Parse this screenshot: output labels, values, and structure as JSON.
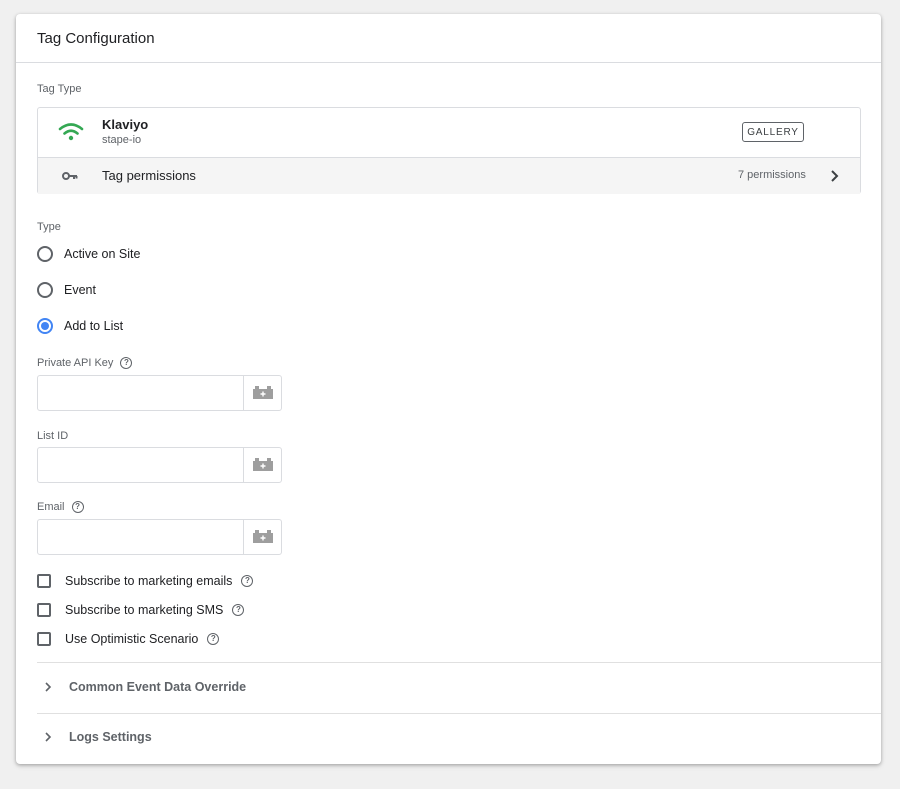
{
  "header": {
    "title": "Tag Configuration"
  },
  "tag_type": {
    "section_label": "Tag Type",
    "name": "Klaviyo",
    "author": "stape-io",
    "logo_icon": "klaviyo-wifi-logo",
    "logo_color": "#34a853",
    "gallery_label": "GALLERY",
    "permissions_icon": "key-icon",
    "permissions_label": "Tag permissions",
    "permissions_count": "7 permissions"
  },
  "type_section": {
    "label": "Type",
    "options": [
      {
        "label": "Active on Site",
        "checked": false
      },
      {
        "label": "Event",
        "checked": false
      },
      {
        "label": "Add to List",
        "checked": true
      }
    ],
    "accent_color": "#4285f4"
  },
  "fields": [
    {
      "label": "Private API Key",
      "has_help": true,
      "value": "",
      "placeholder": ""
    },
    {
      "label": "List ID",
      "has_help": false,
      "value": "",
      "placeholder": ""
    },
    {
      "label": "Email",
      "has_help": true,
      "value": "",
      "placeholder": ""
    }
  ],
  "checkboxes": [
    {
      "label": "Subscribe to marketing emails",
      "checked": false,
      "has_help": true
    },
    {
      "label": "Subscribe to marketing SMS",
      "checked": false,
      "has_help": true
    },
    {
      "label": "Use Optimistic Scenario",
      "checked": false,
      "has_help": true
    }
  ],
  "collapsible_sections": [
    {
      "label": "Common Event Data Override",
      "expanded": false
    },
    {
      "label": "Logs Settings",
      "expanded": false
    }
  ],
  "help_glyph": "?"
}
